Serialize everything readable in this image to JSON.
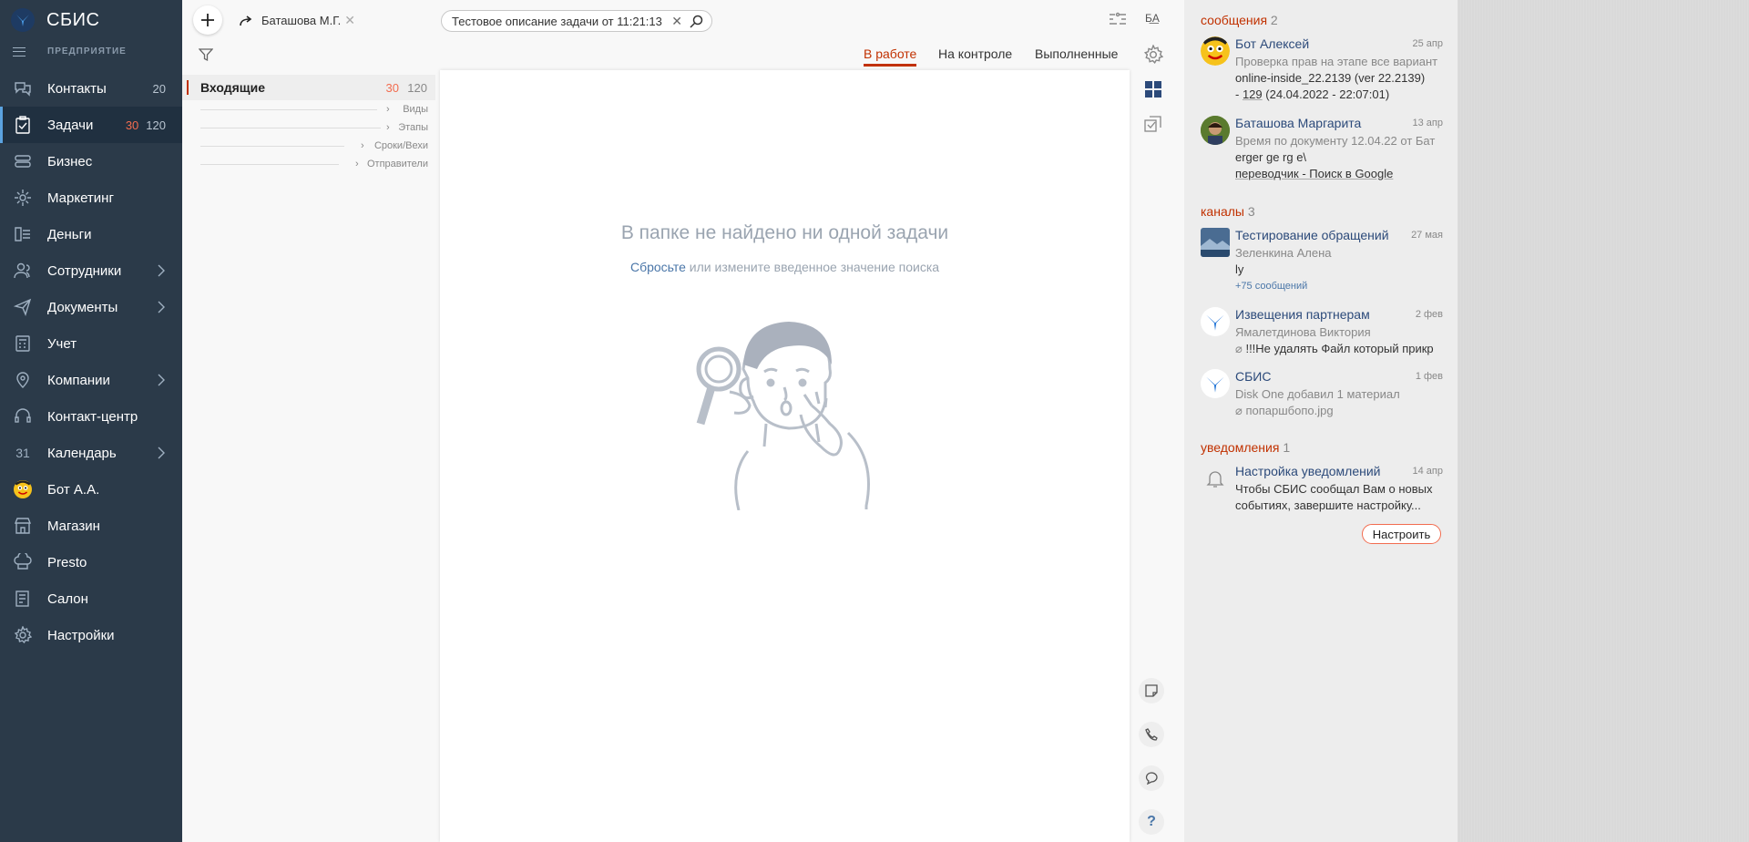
{
  "sidebar": {
    "logo": "СБИС",
    "org": "ПРЕДПРИЯТИЕ",
    "items": [
      {
        "label": "Контакты",
        "count": "20"
      },
      {
        "label": "Задачи",
        "count_new": "30",
        "count": "120"
      },
      {
        "label": "Бизнес"
      },
      {
        "label": "Маркетинг"
      },
      {
        "label": "Деньги"
      },
      {
        "label": "Сотрудники"
      },
      {
        "label": "Документы"
      },
      {
        "label": "Учет"
      },
      {
        "label": "Компании"
      },
      {
        "label": "Контакт-центр"
      },
      {
        "label": "Календарь",
        "icon_text": "31"
      },
      {
        "label": "Бот А.А."
      },
      {
        "label": "Магазин"
      },
      {
        "label": "Presto"
      },
      {
        "label": "Салон"
      },
      {
        "label": "Настройки"
      }
    ]
  },
  "topbar": {
    "user": "Баташова М.Г.",
    "search_value": "Тестовое описание задачи от 11:21:13"
  },
  "tabs": [
    "В работе",
    "На контроле",
    "Выполненные"
  ],
  "folders": {
    "name": "Входящие",
    "count_new": "30",
    "count": "120",
    "sub": [
      "Виды",
      "Этапы",
      "Сроки/Вехи",
      "Отправители"
    ]
  },
  "empty": {
    "title": "В папке не найдено ни одной задачи",
    "reset_link": "Сбросьте",
    "hint": " или измените введенное значение поиска"
  },
  "notifications": {
    "messages_label": "сообщения",
    "messages_count": "2",
    "messages": [
      {
        "title": "Бот Алексей",
        "date": "25 апр",
        "line1": "Проверка прав на этапе все вариант",
        "line2": "online-inside_22.2139 (ver 22.2139)",
        "line3_prefix": "- ",
        "line3_link": "129",
        "line3_suffix": " (24.04.2022 - 22:07:01)"
      },
      {
        "title": "Баташова Маргарита",
        "date": "13 апр",
        "line1": "Время по документу 12.04.22 от Бат",
        "line2": "erger ge rg e\\",
        "line3": "переводчик - Поиск в Google"
      }
    ],
    "channels_label": "каналы",
    "channels_count": "3",
    "channels": [
      {
        "title": "Тестирование обращений",
        "date": "27 мая",
        "line1": "Зеленкина Алена",
        "line2": "ly",
        "more": "+75 сообщений"
      },
      {
        "title": "Извещения партнерам",
        "date": "2 фев",
        "line1": "Ямалетдинова Виктория",
        "line2": "!!!Не удалять Файл который прикр"
      },
      {
        "title": "СБИС",
        "date": "1 фев",
        "line1": "Disk One добавил 1 материал",
        "line2": "попаршбопо.jpg"
      }
    ],
    "alerts_label": "уведомления",
    "alerts_count": "1",
    "alerts": [
      {
        "title": "Настройка уведомлений",
        "date": "14 апр",
        "line1": "Чтобы СБИС сообщал Вам о новых",
        "line2": "событиях, завершите настройку..."
      }
    ],
    "configure_button": "Настроить"
  },
  "colors": {
    "sidebar": "#2b3a49",
    "accent": "#c13100",
    "counter": "#f26c4f",
    "link": "#4a76a8"
  }
}
